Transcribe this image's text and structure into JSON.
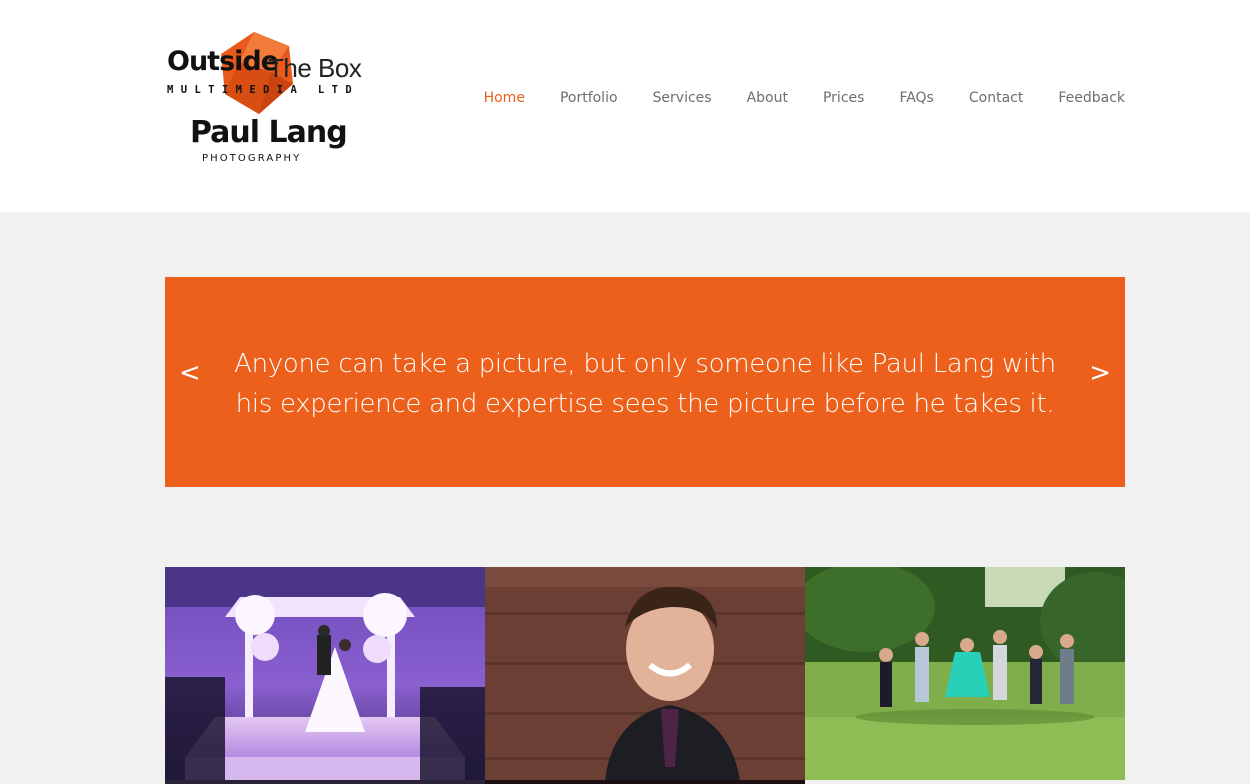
{
  "logo": {
    "line1_a": "Outside",
    "line1_b": "The Box",
    "line2": "MULTIMEDIA LTD",
    "name": "Paul Lang",
    "tagline": "PHOTOGRAPHY"
  },
  "nav": {
    "items": [
      {
        "label": "Home",
        "active": true
      },
      {
        "label": "Portfolio"
      },
      {
        "label": "Services"
      },
      {
        "label": "About"
      },
      {
        "label": "Prices"
      },
      {
        "label": "FAQs"
      },
      {
        "label": "Contact"
      },
      {
        "label": "Feedback"
      }
    ]
  },
  "banner": {
    "prev": "<",
    "next": ">",
    "quote": "Anyone can take a picture, but only someone like Paul Lang with his experience and expertise sees the picture before he takes it."
  },
  "colors": {
    "accent": "#ec601c",
    "background": "#f1f1f2",
    "header": "#ffffff",
    "nav_text": "#6e6e6e"
  }
}
